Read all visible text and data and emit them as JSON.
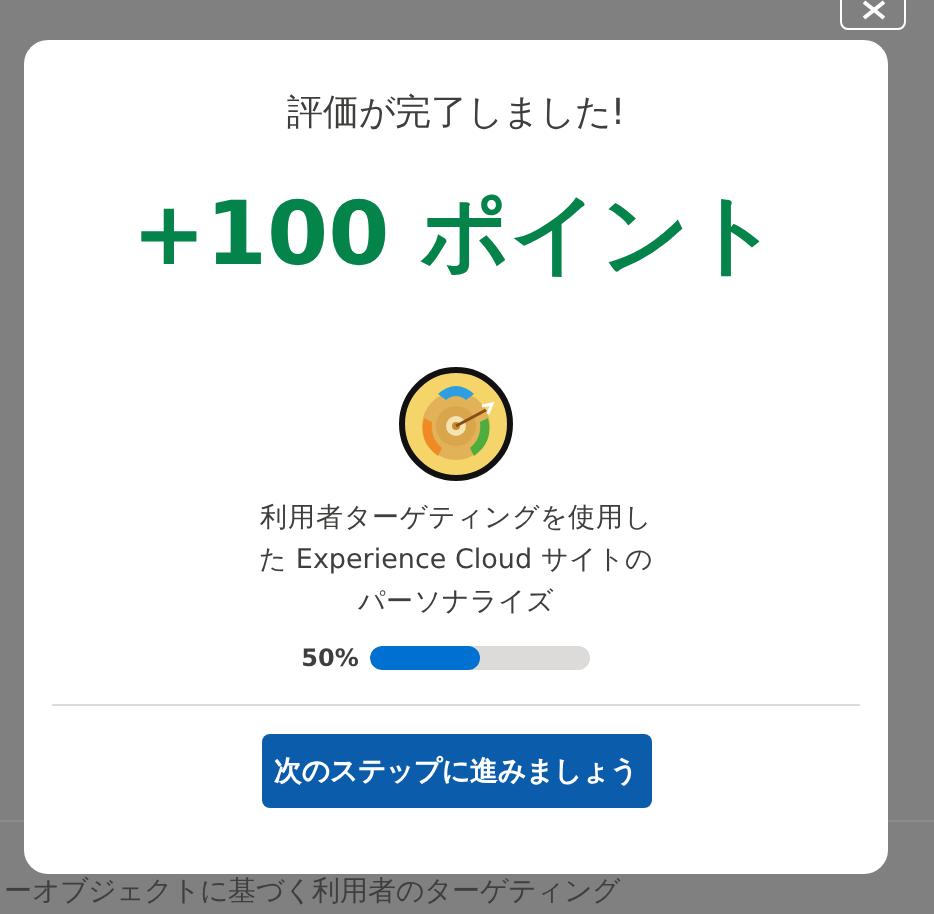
{
  "background": {
    "footer_text": "ーオブジェクトに基づく利用者のターゲティング"
  },
  "modal": {
    "title": "評価が完了しました!",
    "points": "+100 ポイント",
    "description": "利用者ターゲティングを使用した Experience Cloud サイトのパーソナライズ",
    "progress": {
      "label": "50%",
      "level": 0.5
    },
    "button": "次のステップに進みましょう"
  }
}
